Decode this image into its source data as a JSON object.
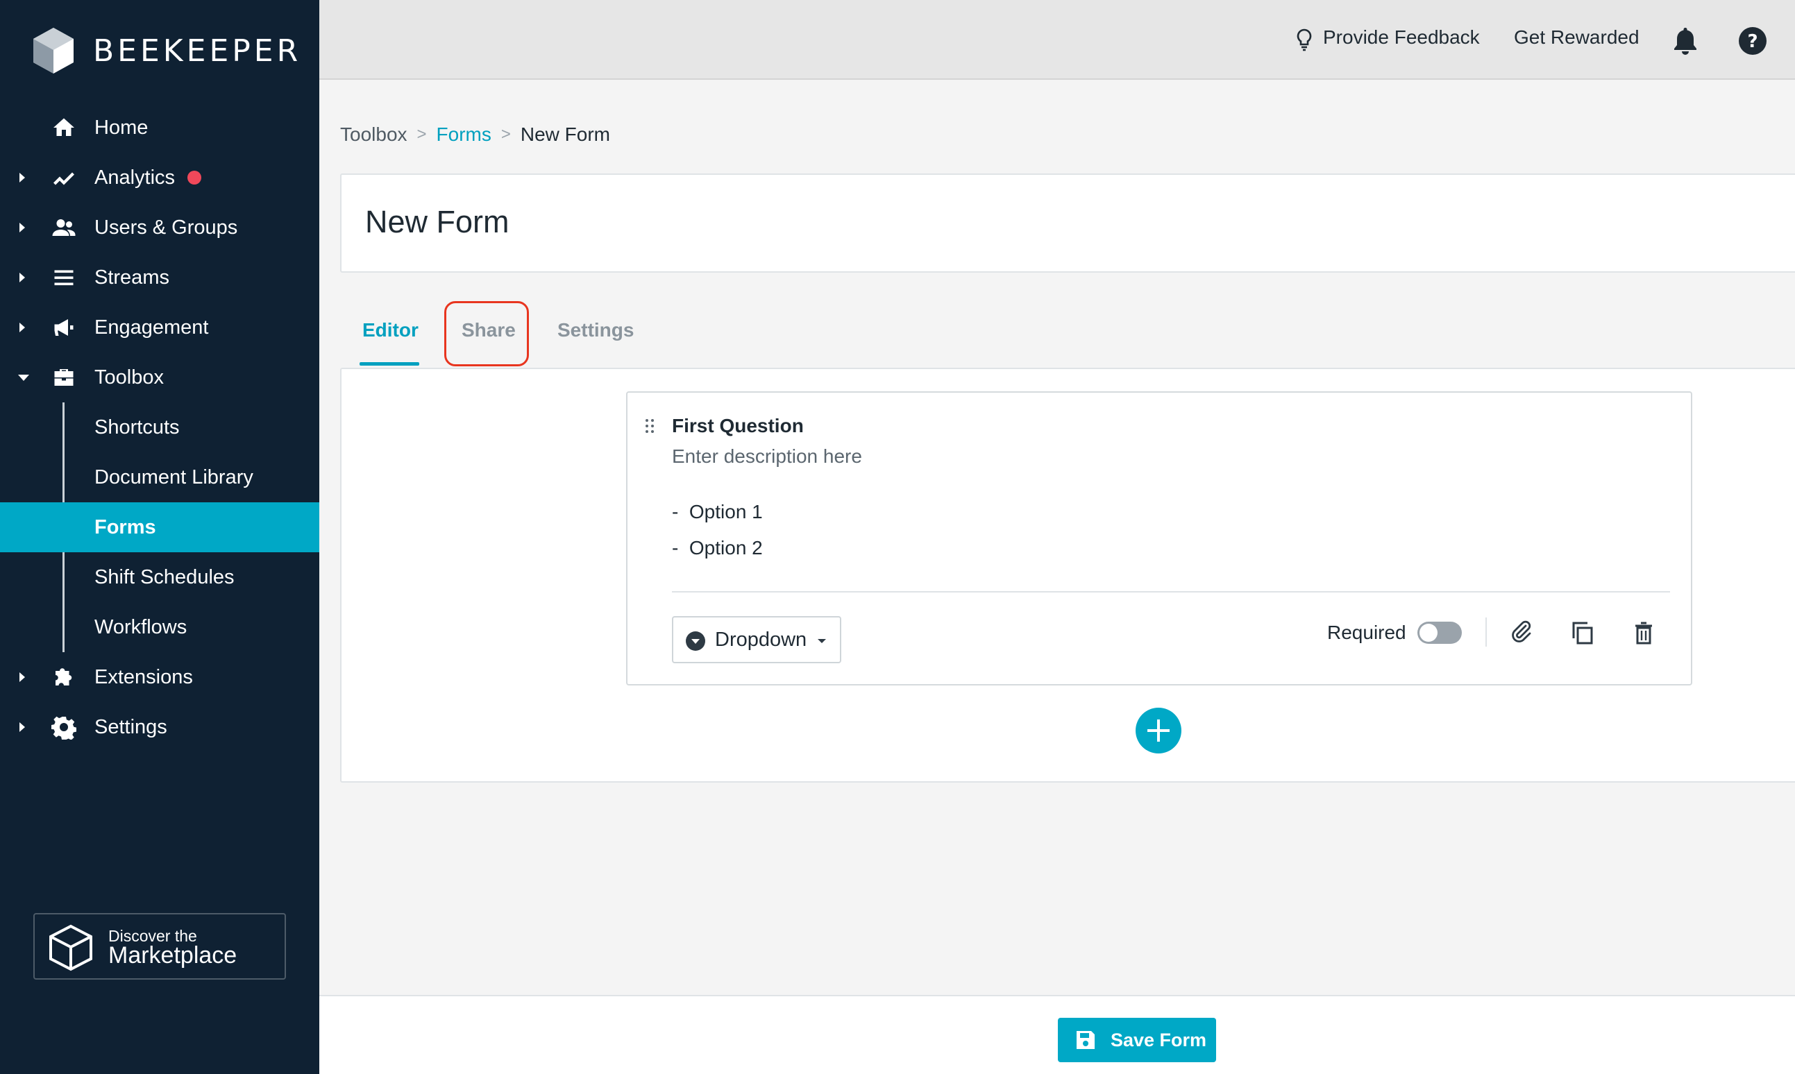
{
  "brand": {
    "name": "BEEKEEPER"
  },
  "sidebar": {
    "items": [
      {
        "label": "Home",
        "icon": "home-icon"
      },
      {
        "label": "Analytics",
        "icon": "analytics-icon",
        "has_notification": true
      },
      {
        "label": "Users & Groups",
        "icon": "users-icon"
      },
      {
        "label": "Streams",
        "icon": "streams-icon"
      },
      {
        "label": "Engagement",
        "icon": "megaphone-icon"
      },
      {
        "label": "Toolbox",
        "icon": "toolbox-icon",
        "expanded": true
      },
      {
        "label": "Extensions",
        "icon": "puzzle-icon"
      },
      {
        "label": "Settings",
        "icon": "gear-icon"
      }
    ],
    "toolbox_children": [
      {
        "label": "Shortcuts"
      },
      {
        "label": "Document Library"
      },
      {
        "label": "Forms",
        "active": true
      },
      {
        "label": "Shift Schedules"
      },
      {
        "label": "Workflows"
      }
    ],
    "marketplace": {
      "line1": "Discover the",
      "line2": "Marketplace"
    }
  },
  "topbar": {
    "feedback_label": "Provide Feedback",
    "rewarded_label": "Get Rewarded"
  },
  "breadcrumb": {
    "items": [
      "Toolbox",
      "Forms",
      "New Form"
    ],
    "separator": ">"
  },
  "page": {
    "title": "New Form"
  },
  "tabs": [
    {
      "label": "Editor",
      "active": true
    },
    {
      "label": "Share",
      "highlighted": true
    },
    {
      "label": "Settings"
    }
  ],
  "question": {
    "title": "First Question",
    "description": "Enter description here",
    "options": [
      "Option 1",
      "Option 2"
    ],
    "option_prefix": "-",
    "type_label": "Dropdown",
    "required_label": "Required",
    "required": false
  },
  "footer": {
    "save_label": "Save Form"
  },
  "colors": {
    "sidebar_bg": "#0f2133",
    "accent": "#00a8c6",
    "link": "#00a0bf",
    "notification": "#f0485a",
    "highlight": "#e8351f"
  }
}
